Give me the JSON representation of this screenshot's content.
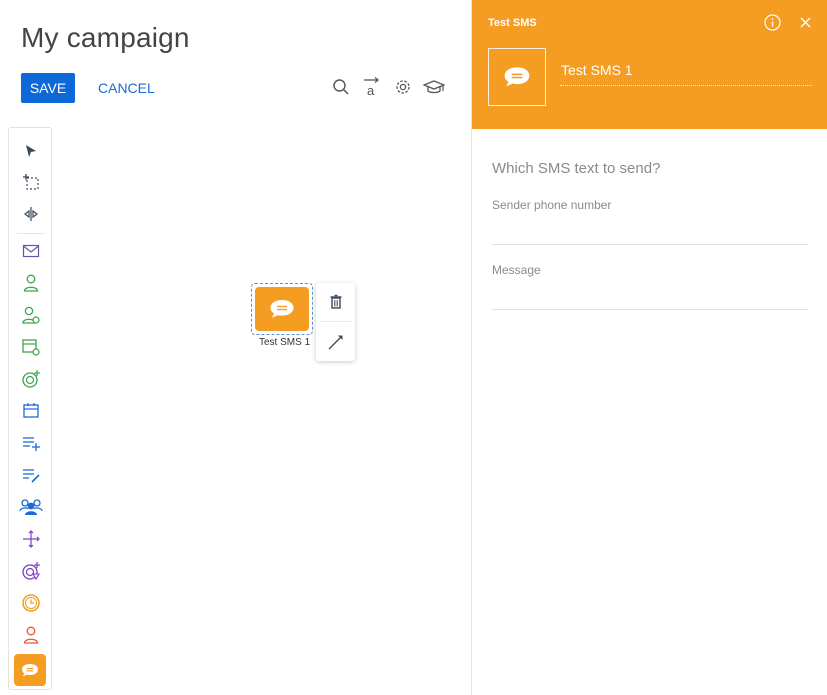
{
  "page": {
    "title": "My campaign"
  },
  "toolbar": {
    "save_label": "SAVE",
    "cancel_label": "CANCEL",
    "icons": [
      "search-icon",
      "text-format-icon",
      "gear-icon",
      "graduation-cap-icon"
    ]
  },
  "palette": {
    "items": [
      "pointer-icon",
      "selection-icon",
      "split-icon",
      "email-icon",
      "audience-icon",
      "audience-add-icon",
      "calendar-add-icon",
      "target-add-icon",
      "calendar-icon",
      "add-list-icon",
      "edit-list-icon",
      "group-icon",
      "move-icon",
      "target-filter-icon",
      "timer-icon",
      "contact-icon",
      "sms-icon"
    ]
  },
  "canvas": {
    "node": {
      "label": "Test SMS 1",
      "icon": "sms-bubble-icon"
    },
    "menu": [
      "delete-icon",
      "connect-arrow-icon"
    ]
  },
  "panel": {
    "header_title": "Test SMS",
    "element_name": "Test SMS 1",
    "question": "Which SMS text to send?",
    "fields": {
      "sender": {
        "label": "Sender phone number",
        "value": ""
      },
      "message": {
        "label": "Message",
        "value": ""
      }
    }
  },
  "colors": {
    "accent": "#f59d23",
    "primary": "#0d69d9",
    "link": "#1c6bd6"
  }
}
